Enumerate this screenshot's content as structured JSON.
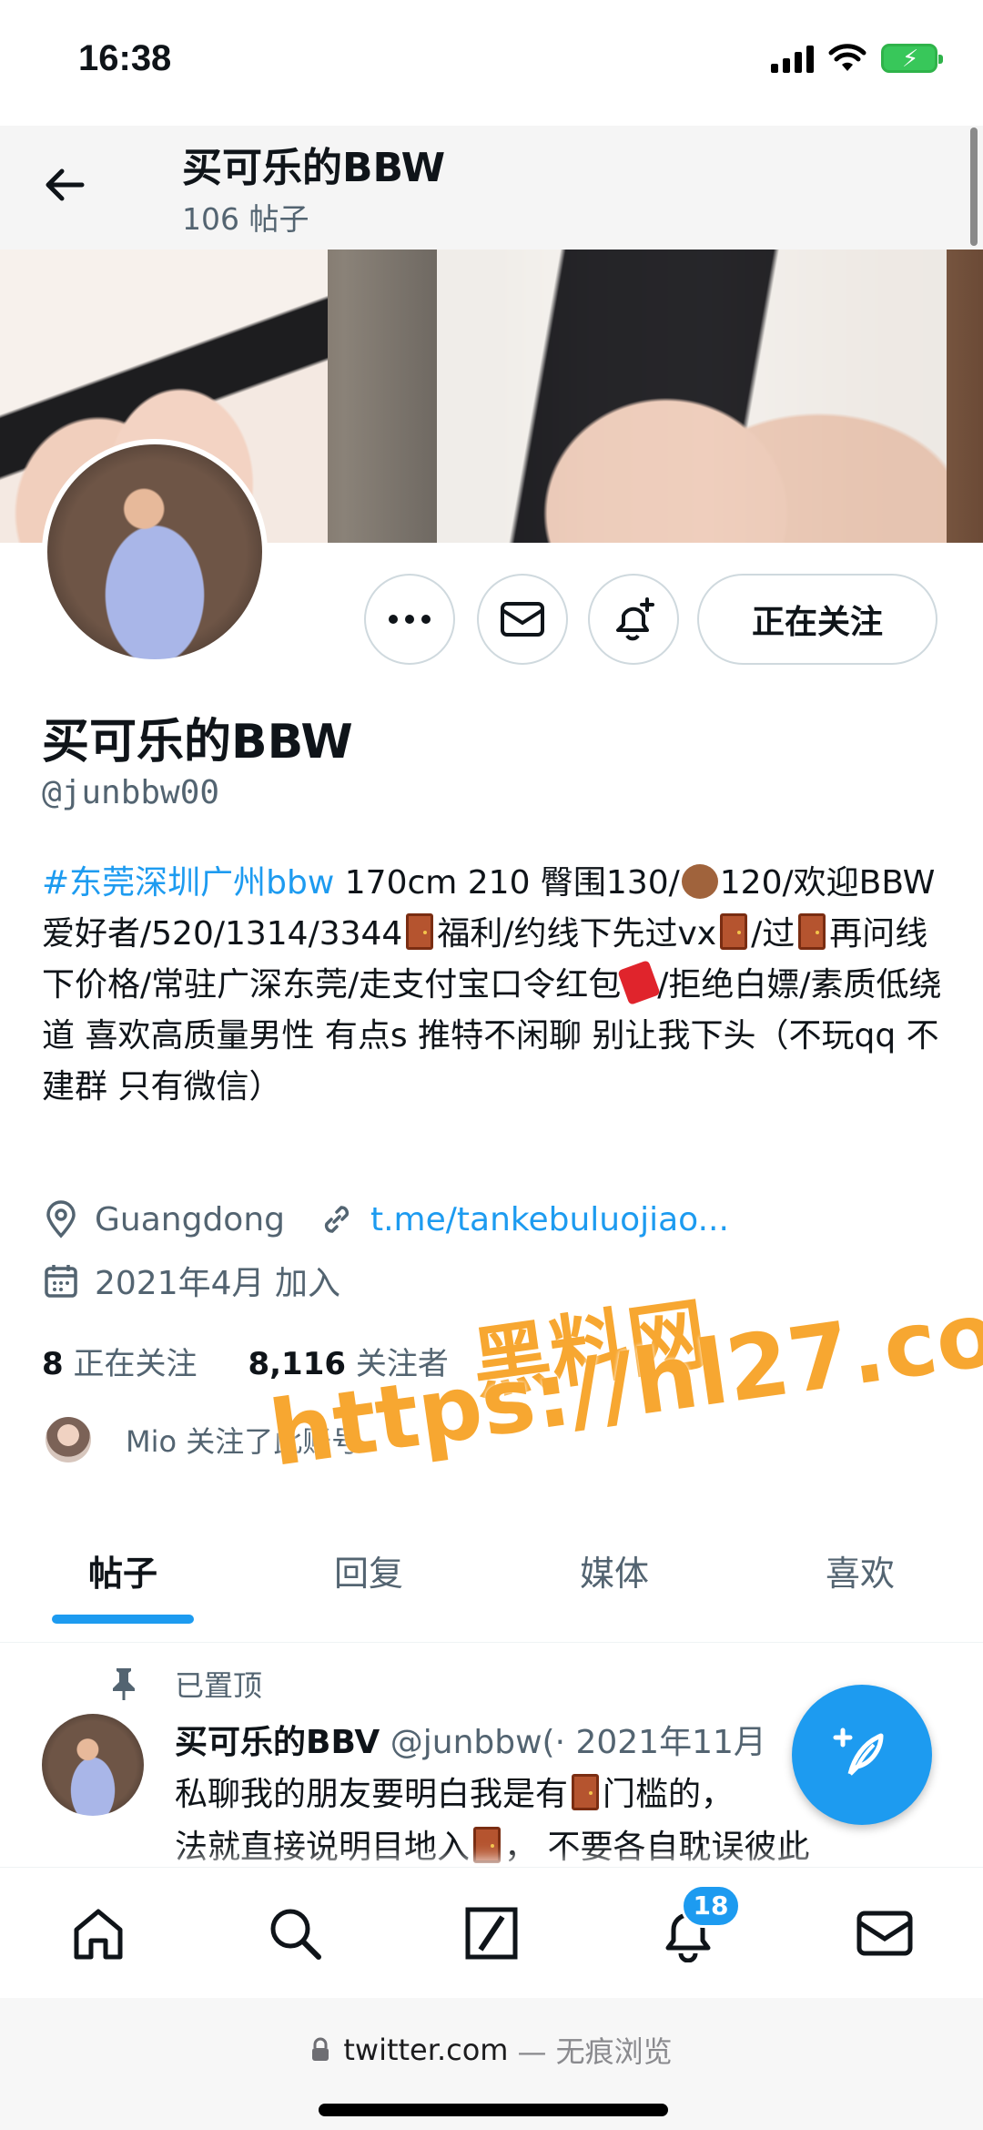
{
  "status_bar": {
    "time": "16:38"
  },
  "header": {
    "title": "买可乐的BBW",
    "post_count": "106 帖子"
  },
  "profile": {
    "follow_label": "正在关注",
    "name": "买可乐的BBW",
    "handle": "@junbbw00",
    "bio": {
      "tag": "#东莞深圳广州bbw",
      "part1": " 170cm 210 臀围130/",
      "part2": "120/欢迎BBW爱好者/520/1314/3344",
      "part3": "福利/约线下先过vx",
      "part4": "/过",
      "part5": "再问线下价格/常驻广深东莞/走支付宝口令红包",
      "part6": "/拒绝白嫖/素质低绕道 喜欢高质量男性 有点s 推特不闲聊 别让我下头（不玩qq 不建群 只有微信）"
    },
    "location": "Guangdong",
    "link": "t.me/tankebuluojiao...",
    "joined": "2021年4月 加入",
    "following_count": "8",
    "following_label": "正在关注",
    "followers_count": "8,116",
    "followers_label": "关注者",
    "followed_by": "Mio 关注了此账号"
  },
  "watermark": {
    "line1": "黑料网",
    "line2": "https://hl27.co"
  },
  "tabs": [
    {
      "label": "帖子",
      "active": true
    },
    {
      "label": "回复",
      "active": false
    },
    {
      "label": "媒体",
      "active": false
    },
    {
      "label": "喜欢",
      "active": false
    }
  ],
  "tweet": {
    "pinned_label": "已置顶",
    "name": "买可乐的BBV",
    "handle": "@junbbw(",
    "date": "· 2021年11月",
    "text_part1": "私聊我的朋友要明白我是有",
    "text_part2": "门槛的，",
    "text_part3": "法就直接说明目地入",
    "text_part4": "， 不要各自耽误彼此"
  },
  "nav": {
    "notification_badge": "18"
  },
  "browser": {
    "url": "twitter.com",
    "mode": "— 无痕浏览"
  },
  "colors": {
    "accent": "#1d9bf0",
    "watermark": "#f7a731",
    "secondary_text": "#536471"
  }
}
